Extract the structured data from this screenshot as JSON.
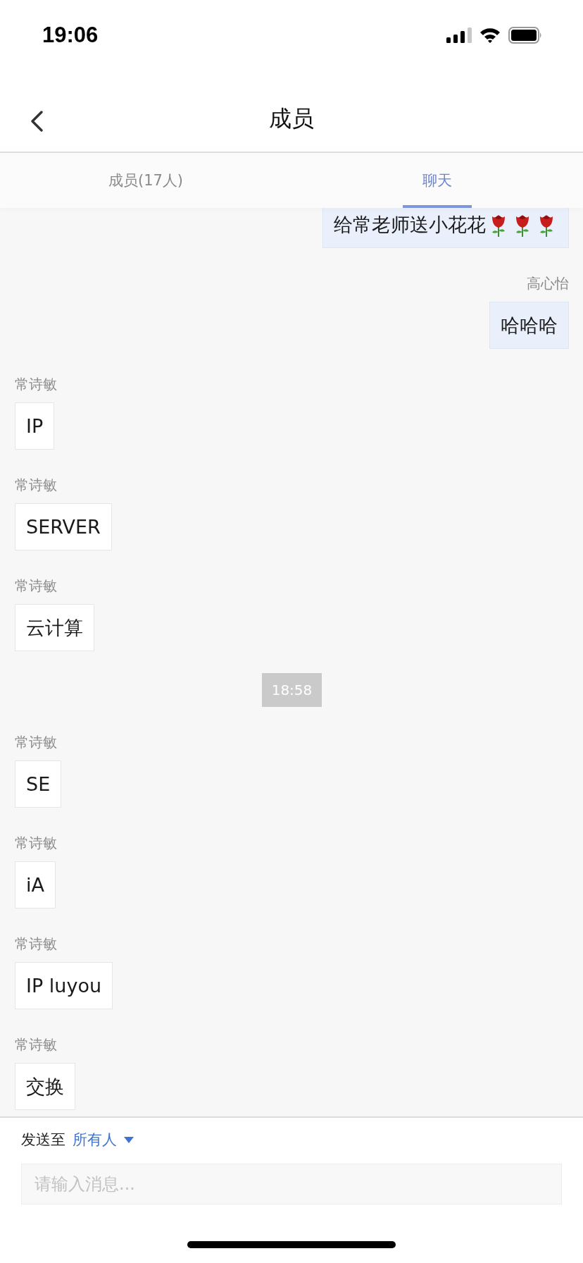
{
  "status_bar": {
    "time": "19:06"
  },
  "nav": {
    "title": "成员"
  },
  "tabs": [
    {
      "label": "成员(17人)",
      "selected": false
    },
    {
      "label": "聊天",
      "selected": true
    }
  ],
  "messages": [
    {
      "kind": "outgoing",
      "text": "给常老师送小花花",
      "stickers": [
        {
          "kind": "rose"
        },
        {
          "kind": "rose"
        },
        {
          "kind": "rose"
        }
      ]
    },
    {
      "kind": "outgoing",
      "sender": "高心怡",
      "text": "哈哈哈"
    },
    {
      "kind": "incoming",
      "sender": "常诗敏",
      "text": "IP"
    },
    {
      "kind": "incoming",
      "sender": "常诗敏",
      "text": "SERVER"
    },
    {
      "kind": "incoming",
      "sender": "常诗敏",
      "text": "云计算"
    },
    {
      "kind": "time",
      "text": "18:58"
    },
    {
      "kind": "incoming",
      "sender": "常诗敏",
      "text": "SE"
    },
    {
      "kind": "incoming",
      "sender": "常诗敏",
      "text": "iA"
    },
    {
      "kind": "incoming",
      "sender": "常诗敏",
      "text": "IP luyou"
    },
    {
      "kind": "incoming",
      "sender": "常诗敏",
      "text": "交换"
    }
  ],
  "composer": {
    "send_to_label": "发送至",
    "recipient": "所有人",
    "placeholder": "请输入消息..."
  }
}
